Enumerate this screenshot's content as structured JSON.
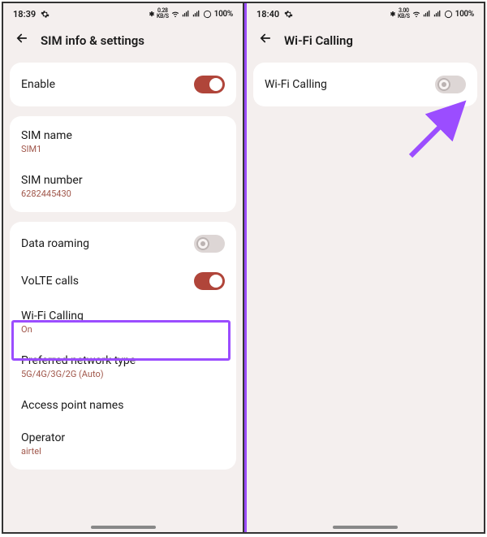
{
  "left": {
    "status": {
      "time": "18:39",
      "indicators": "✻ ᴷᴮ/ˢ ⏸ 📶 ⚪100%",
      "battery_text": "100%",
      "speed": "0.28",
      "speed_unit": "KB/S"
    },
    "header": {
      "title": "SIM info & settings"
    },
    "enable": {
      "label": "Enable"
    },
    "sim_name": {
      "label": "SIM name",
      "value": "SIM1"
    },
    "sim_number": {
      "label": "SIM number",
      "value": "6282445430"
    },
    "data_roaming": {
      "label": "Data roaming"
    },
    "volte": {
      "label": "VoLTE calls"
    },
    "wifi_calling": {
      "label": "Wi-Fi Calling",
      "value": "On"
    },
    "pref_network": {
      "label": "Preferred network type",
      "value": "5G/4G/3G/2G (Auto)"
    },
    "apn": {
      "label": "Access point names"
    },
    "operator": {
      "label": "Operator",
      "value": "airtel"
    }
  },
  "right": {
    "status": {
      "time": "18:40",
      "battery_text": "100%",
      "speed": "3.00",
      "speed_unit": "KB/S"
    },
    "header": {
      "title": "Wi-Fi Calling"
    },
    "wifi_calling": {
      "label": "Wi-Fi Calling"
    }
  }
}
